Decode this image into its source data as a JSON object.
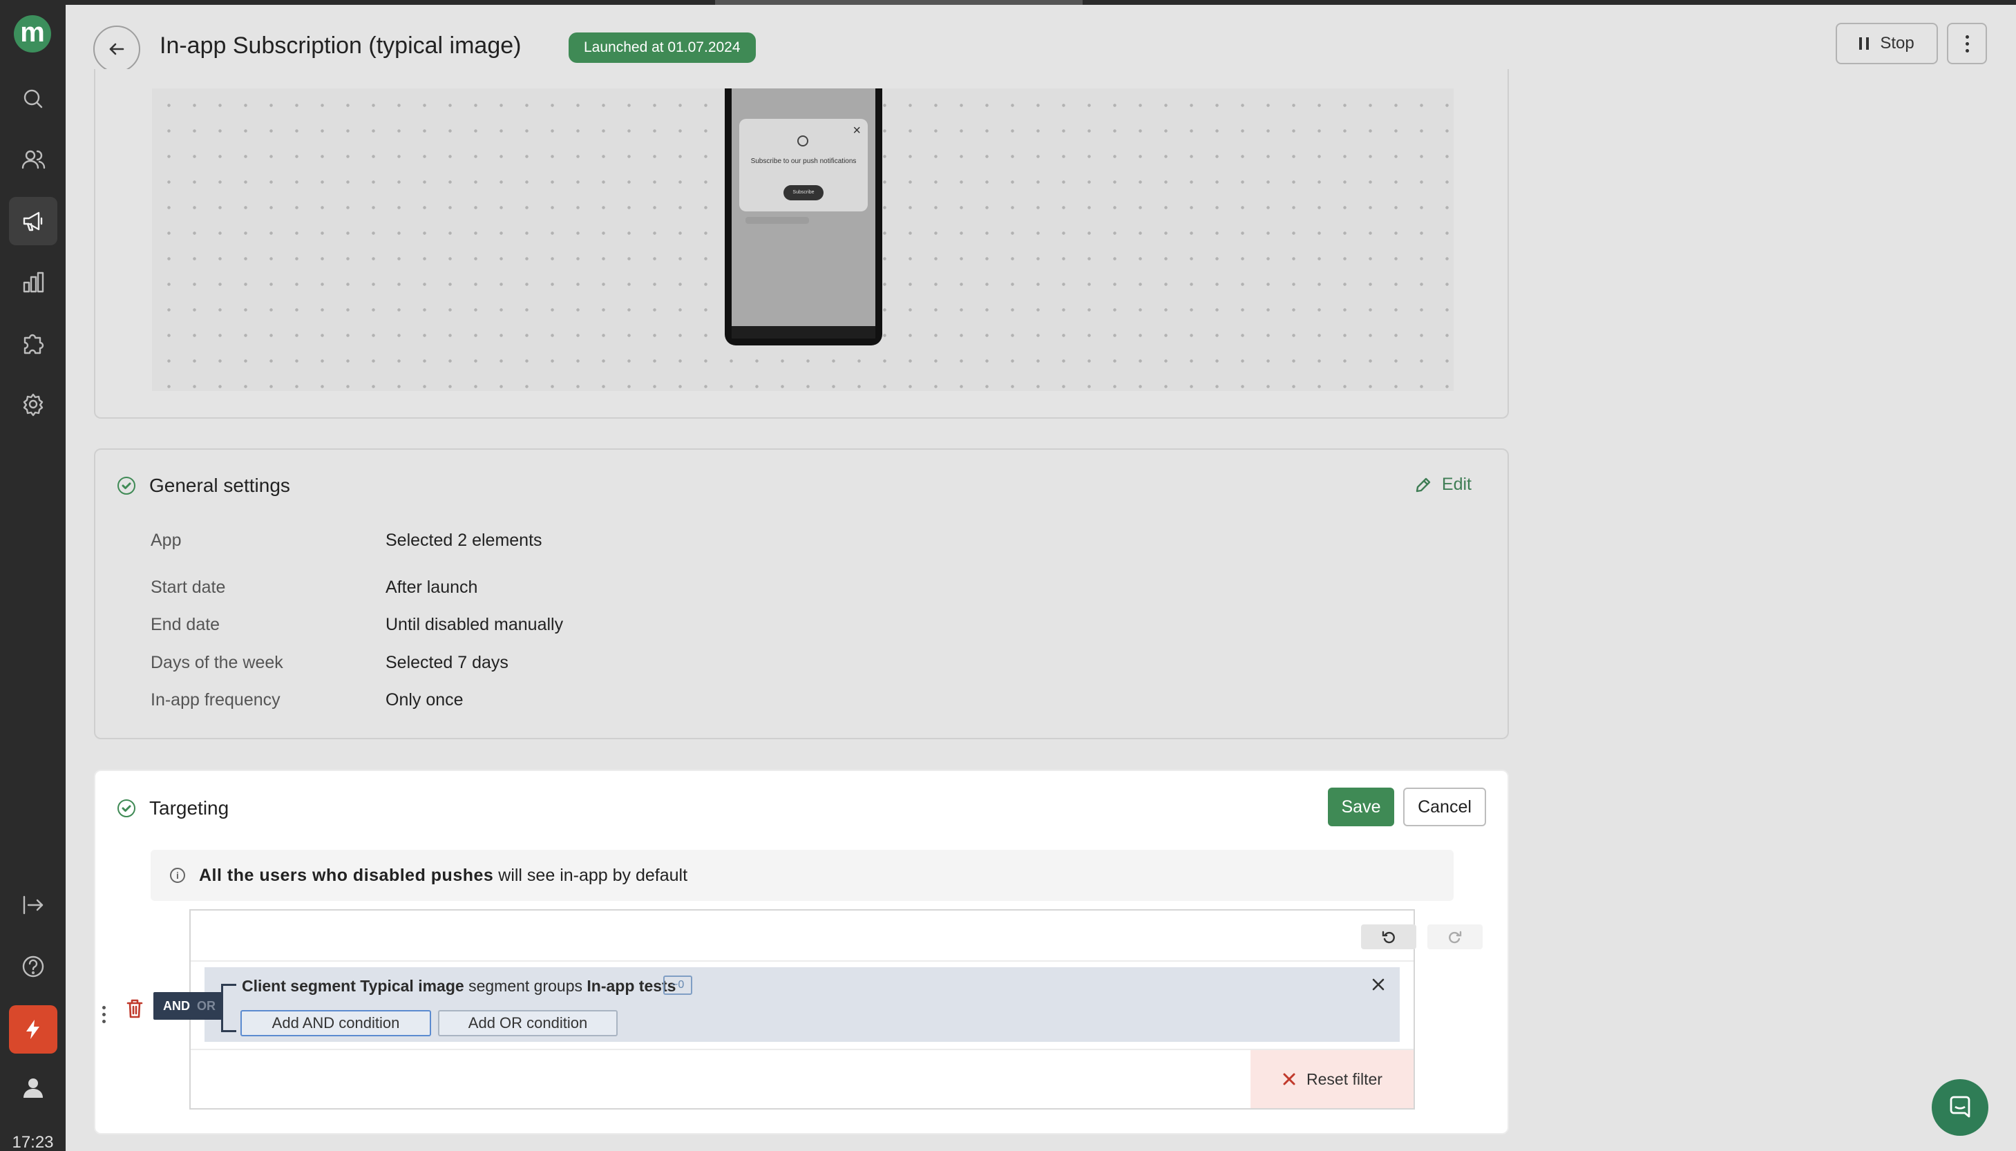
{
  "sidebar": {
    "logo_letter": "m",
    "time": "17:23",
    "items": [
      {
        "name": "search-icon"
      },
      {
        "name": "users-icon"
      },
      {
        "name": "megaphone-icon"
      },
      {
        "name": "bar-chart-icon"
      },
      {
        "name": "puzzle-icon"
      },
      {
        "name": "gear-icon"
      },
      {
        "name": "logout-icon"
      },
      {
        "name": "help-icon"
      },
      {
        "name": "lightning-icon"
      },
      {
        "name": "user-icon"
      }
    ]
  },
  "header": {
    "title": "In-app Subscription (typical image)",
    "status_badge": "Launched at 01.07.2024",
    "stop_label": "Stop"
  },
  "preview": {
    "popup_text": "Subscribe to our push notifications",
    "popup_button": "Subscribe"
  },
  "general_settings": {
    "title": "General settings",
    "edit_label": "Edit",
    "rows": [
      {
        "label": "App",
        "value": "Selected 2 elements"
      },
      {
        "label": "Start date",
        "value": "After launch"
      },
      {
        "label": "End date",
        "value": "Until disabled manually"
      },
      {
        "label": "Days of the week",
        "value": "Selected 7 days"
      },
      {
        "label": "In-app frequency",
        "value": "Only once"
      }
    ]
  },
  "targeting": {
    "title": "Targeting",
    "save_label": "Save",
    "cancel_label": "Cancel",
    "info_bold": "All the users who disabled pushes",
    "info_rest": " will see in-app by default",
    "logic_and": "AND",
    "logic_or": "OR",
    "condition": {
      "part1": "Client segment ",
      "segment": "Typical image",
      "part2": " segment groups ",
      "group": "In-app tests",
      "count": "~0"
    },
    "add_and_label": "Add AND condition",
    "add_or_label": "Add OR condition",
    "reset_label": "Reset filter"
  },
  "colors": {
    "accent": "#3f8a55",
    "sidebar_bg": "#2b2b2b",
    "danger": "#c0392b",
    "lightning_bg": "#d9482b"
  }
}
